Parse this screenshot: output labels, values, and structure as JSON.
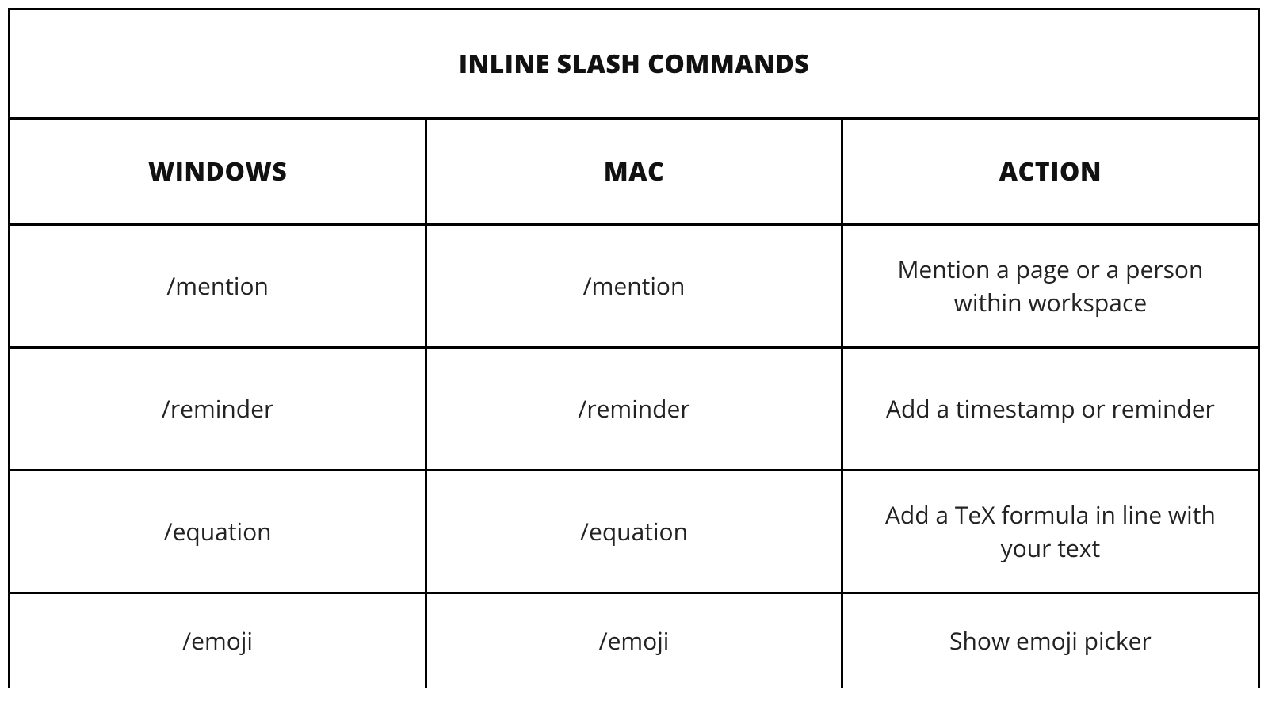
{
  "title": "INLINE SLASH COMMANDS",
  "columns": {
    "windows": "WINDOWS",
    "mac": "MAC",
    "action": "ACTION"
  },
  "rows": [
    {
      "windows": "/mention",
      "mac": "/mention",
      "action": "Mention a page or a person within workspace"
    },
    {
      "windows": "/reminder",
      "mac": "/reminder",
      "action": "Add a timestamp or reminder"
    },
    {
      "windows": "/equation",
      "mac": "/equation",
      "action": "Add a TeX formula in line with your text"
    },
    {
      "windows": "/emoji",
      "mac": "/emoji",
      "action": "Show emoji picker"
    }
  ],
  "chart_data": {
    "type": "table",
    "title": "INLINE SLASH COMMANDS",
    "columns": [
      "WINDOWS",
      "MAC",
      "ACTION"
    ],
    "rows": [
      [
        "/mention",
        "/mention",
        "Mention a page or a person within workspace"
      ],
      [
        "/reminder",
        "/reminder",
        "Add a timestamp or reminder"
      ],
      [
        "/equation",
        "/equation",
        "Add a TeX formula in line with your text"
      ],
      [
        "/emoji",
        "/emoji",
        "Show emoji picker"
      ]
    ]
  }
}
